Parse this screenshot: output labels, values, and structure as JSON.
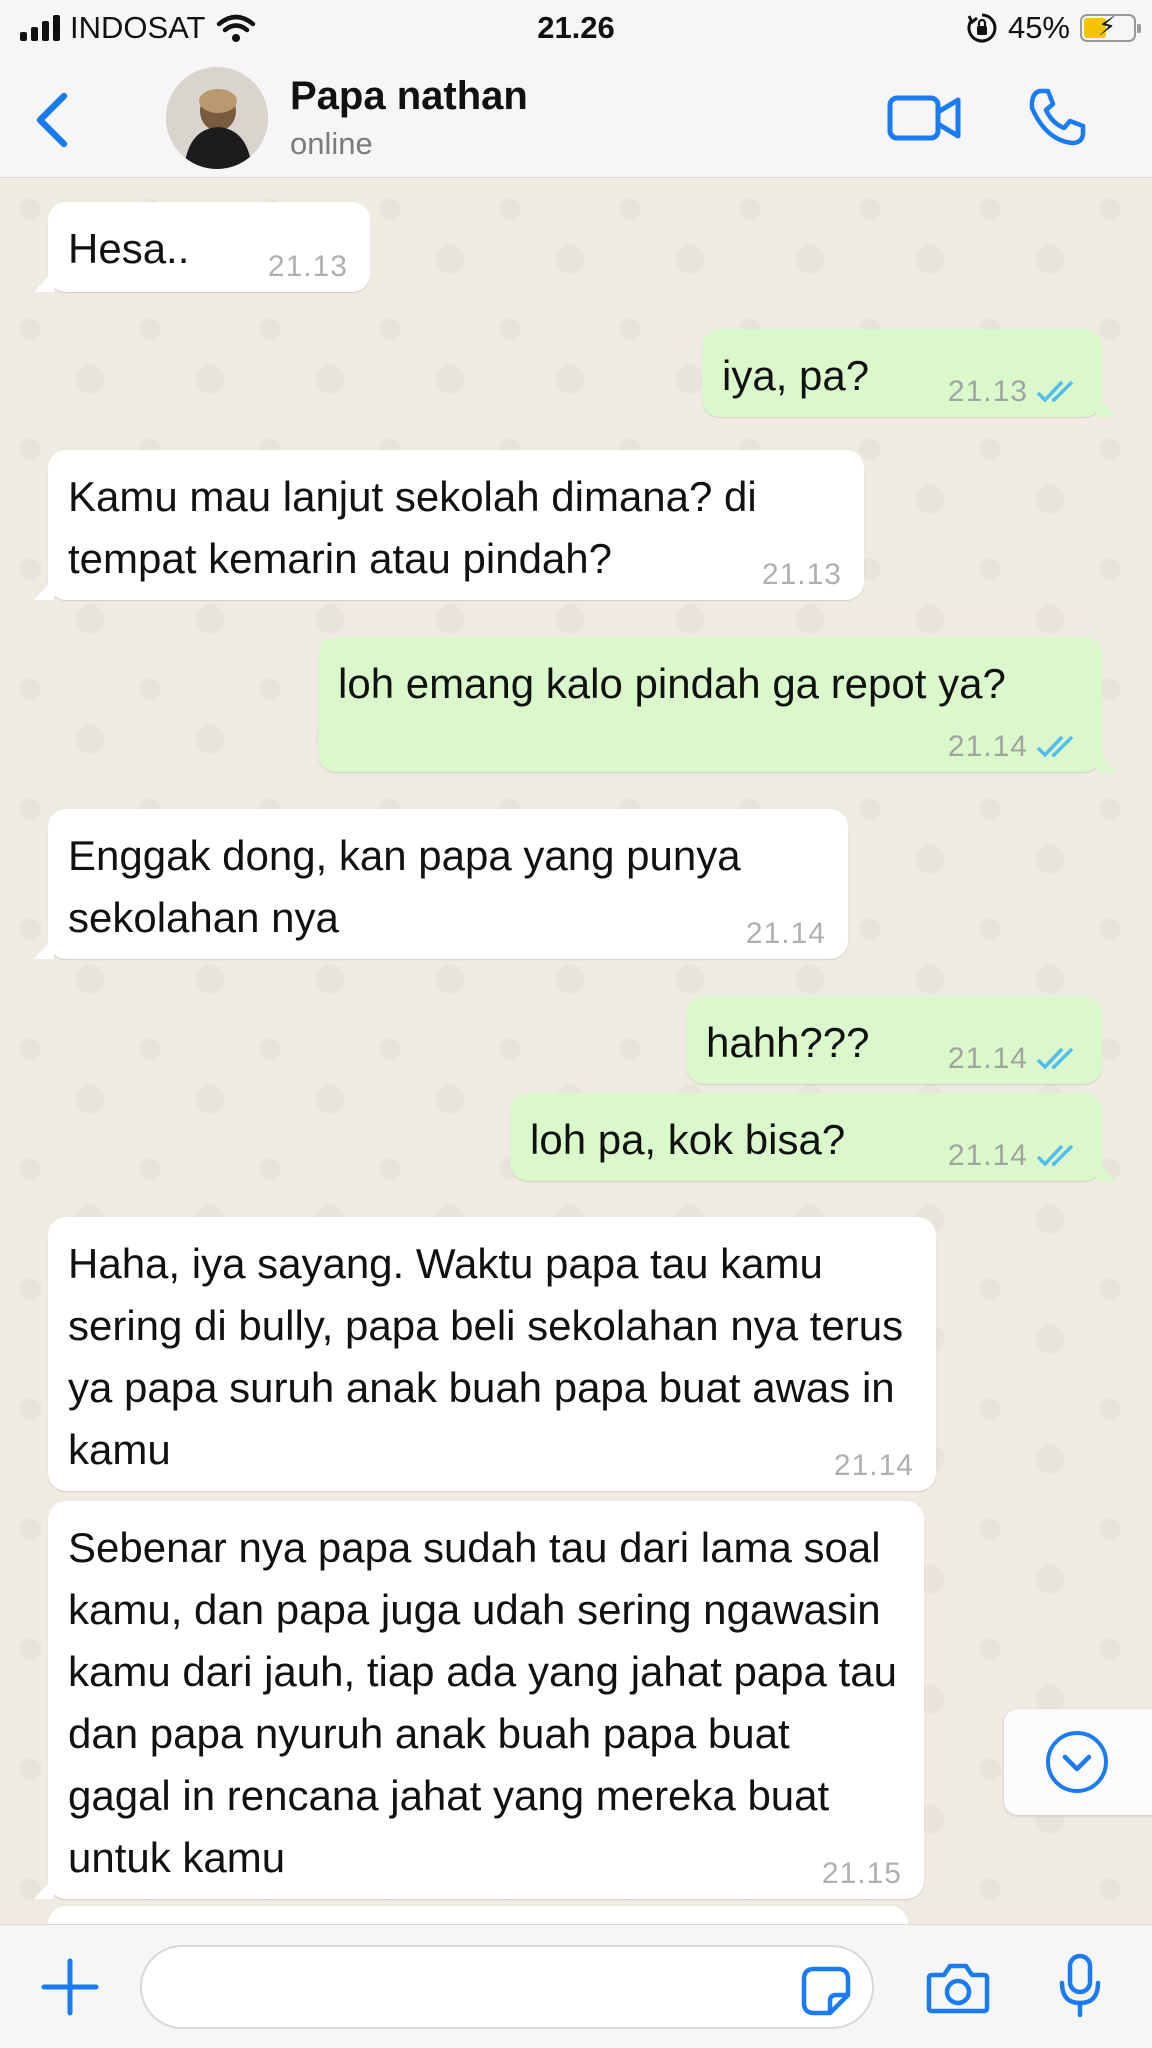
{
  "status_bar": {
    "carrier": "INDOSAT",
    "time": "21.26",
    "battery": "45%",
    "battery_level": 0.45
  },
  "header": {
    "contact_name": "Papa nathan",
    "contact_status": "online"
  },
  "messages": [
    {
      "dir": "in",
      "text": "Hesa..",
      "time": "21.13"
    },
    {
      "dir": "out",
      "text": "iya, pa?",
      "time": "21.13",
      "read": true
    },
    {
      "dir": "in",
      "text": "Kamu mau lanjut sekolah dimana? di tempat kemarin atau pindah?",
      "time": "21.13"
    },
    {
      "dir": "out",
      "text": "loh emang kalo pindah ga repot ya?",
      "time": "21.14",
      "read": true
    },
    {
      "dir": "in",
      "text": "Enggak dong, kan papa yang punya sekolahan nya",
      "time": "21.14"
    },
    {
      "dir": "out",
      "text": "hahh???",
      "time": "21.14",
      "read": true
    },
    {
      "dir": "out",
      "text": "loh pa, kok bisa?",
      "time": "21.14",
      "read": true
    },
    {
      "dir": "in",
      "text": "Haha, iya sayang. Waktu papa tau kamu sering di bully, papa beli sekolahan nya terus ya papa suruh anak buah papa buat awas in kamu",
      "time": "21.14"
    },
    {
      "dir": "in",
      "text": "Sebenar nya papa sudah tau dari lama soal kamu, dan papa juga udah sering ngawasin kamu dari jauh, tiap ada yang jahat papa tau dan papa nyuruh anak buah papa buat gagal in rencana jahat yang mereka buat untuk kamu",
      "time": "21.15"
    }
  ],
  "input": {
    "value": "",
    "placeholder": ""
  },
  "colors": {
    "accent": "#1a7cf0",
    "outgoing_bubble": "#daf8cb",
    "incoming_bubble": "#ffffff",
    "read_ticks": "#53bdeb",
    "chat_background": "#efeae2"
  }
}
